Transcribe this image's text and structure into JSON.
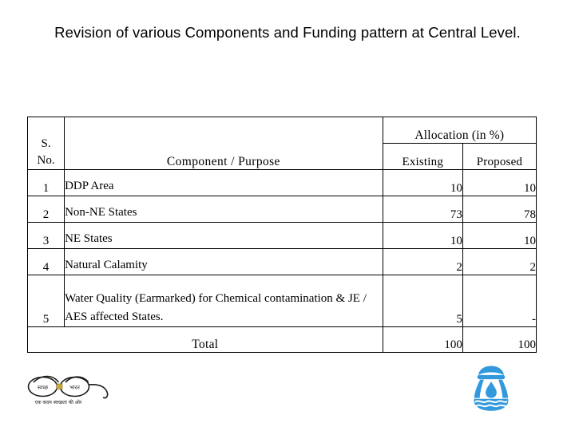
{
  "slide": {
    "title": "Revision of various Components and Funding pattern at Central Level."
  },
  "table": {
    "headers": {
      "sno": "S.\nNo.",
      "sno_line1": "S.",
      "sno_line2": "No.",
      "component": "Component / Purpose",
      "allocation": "Allocation (in %)",
      "existing": "Existing",
      "proposed": "Proposed"
    },
    "rows": [
      {
        "sno": "1",
        "component": "DDP Area",
        "existing": "10",
        "proposed": "10"
      },
      {
        "sno": "2",
        "component": "Non-NE States",
        "existing": "73",
        "proposed": "78"
      },
      {
        "sno": "3",
        "component": "NE States",
        "existing": "10",
        "proposed": "10"
      },
      {
        "sno": "4",
        "component": "Natural Calamity",
        "existing": "2",
        "proposed": "2"
      },
      {
        "sno": "5",
        "component": "Water Quality (Earmarked) for Chemical contamination & JE / AES affected States.",
        "existing": "5",
        "proposed": "-"
      }
    ],
    "total": {
      "label": "Total",
      "existing": "100",
      "proposed": "100"
    }
  },
  "logos": {
    "swachh_bharat": {
      "name": "swachh-bharat-logo",
      "lens_left_text": "स्वच्छ",
      "lens_right_text": "भारत",
      "tagline": "एक कदम स्वच्छता की ओर",
      "bridge_color": "#C8A93A",
      "stroke_color": "#1A1A1A"
    },
    "water_pot": {
      "name": "water-pot-logo",
      "color": "#3399DD"
    }
  }
}
